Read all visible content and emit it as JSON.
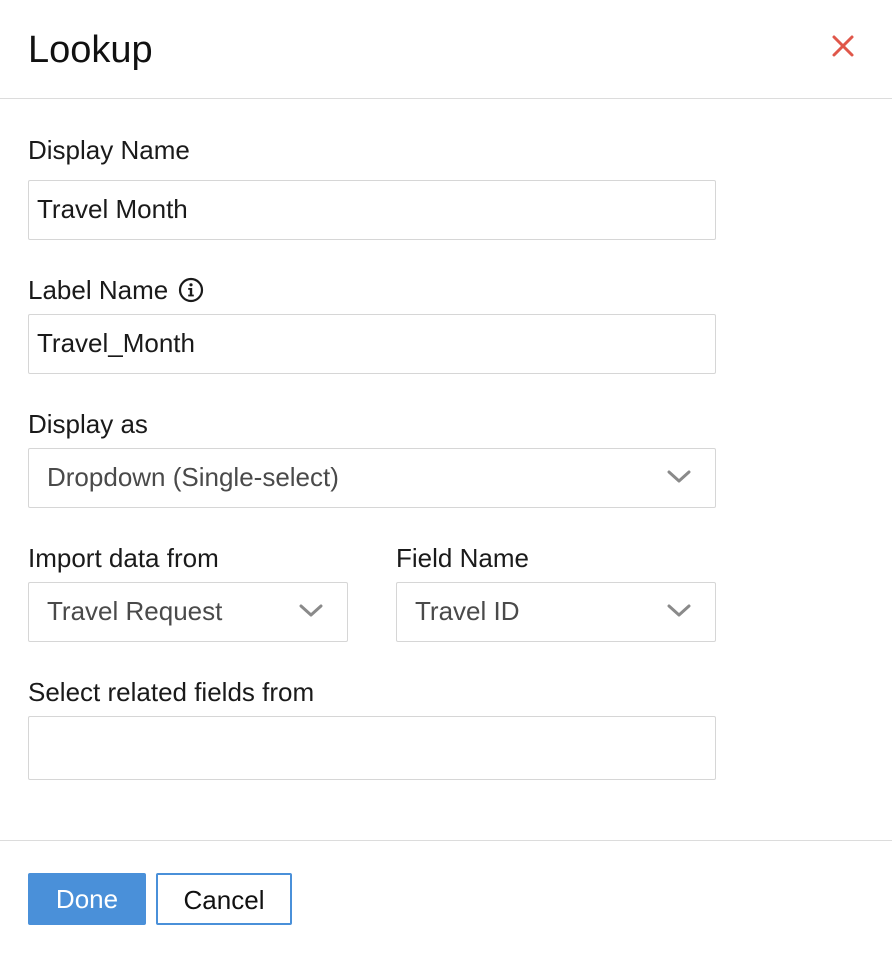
{
  "dialog": {
    "title": "Lookup",
    "close_icon": "close-icon"
  },
  "form": {
    "display_name": {
      "label": "Display Name",
      "value": "Travel Month"
    },
    "label_name": {
      "label": "Label Name",
      "value": "Travel_Month",
      "info_icon": "info-icon"
    },
    "display_as": {
      "label": "Display as",
      "value": "Dropdown (Single-select)"
    },
    "import_data_from": {
      "label": "Import data from",
      "value": "Travel Request"
    },
    "field_name": {
      "label": "Field Name",
      "value": "Travel ID"
    },
    "related_fields": {
      "label": "Select related fields from",
      "value": ""
    }
  },
  "footer": {
    "done_label": "Done",
    "cancel_label": "Cancel"
  },
  "colors": {
    "accent": "#4a90d9",
    "close": "#e0574a",
    "border": "#d6d6d6"
  }
}
